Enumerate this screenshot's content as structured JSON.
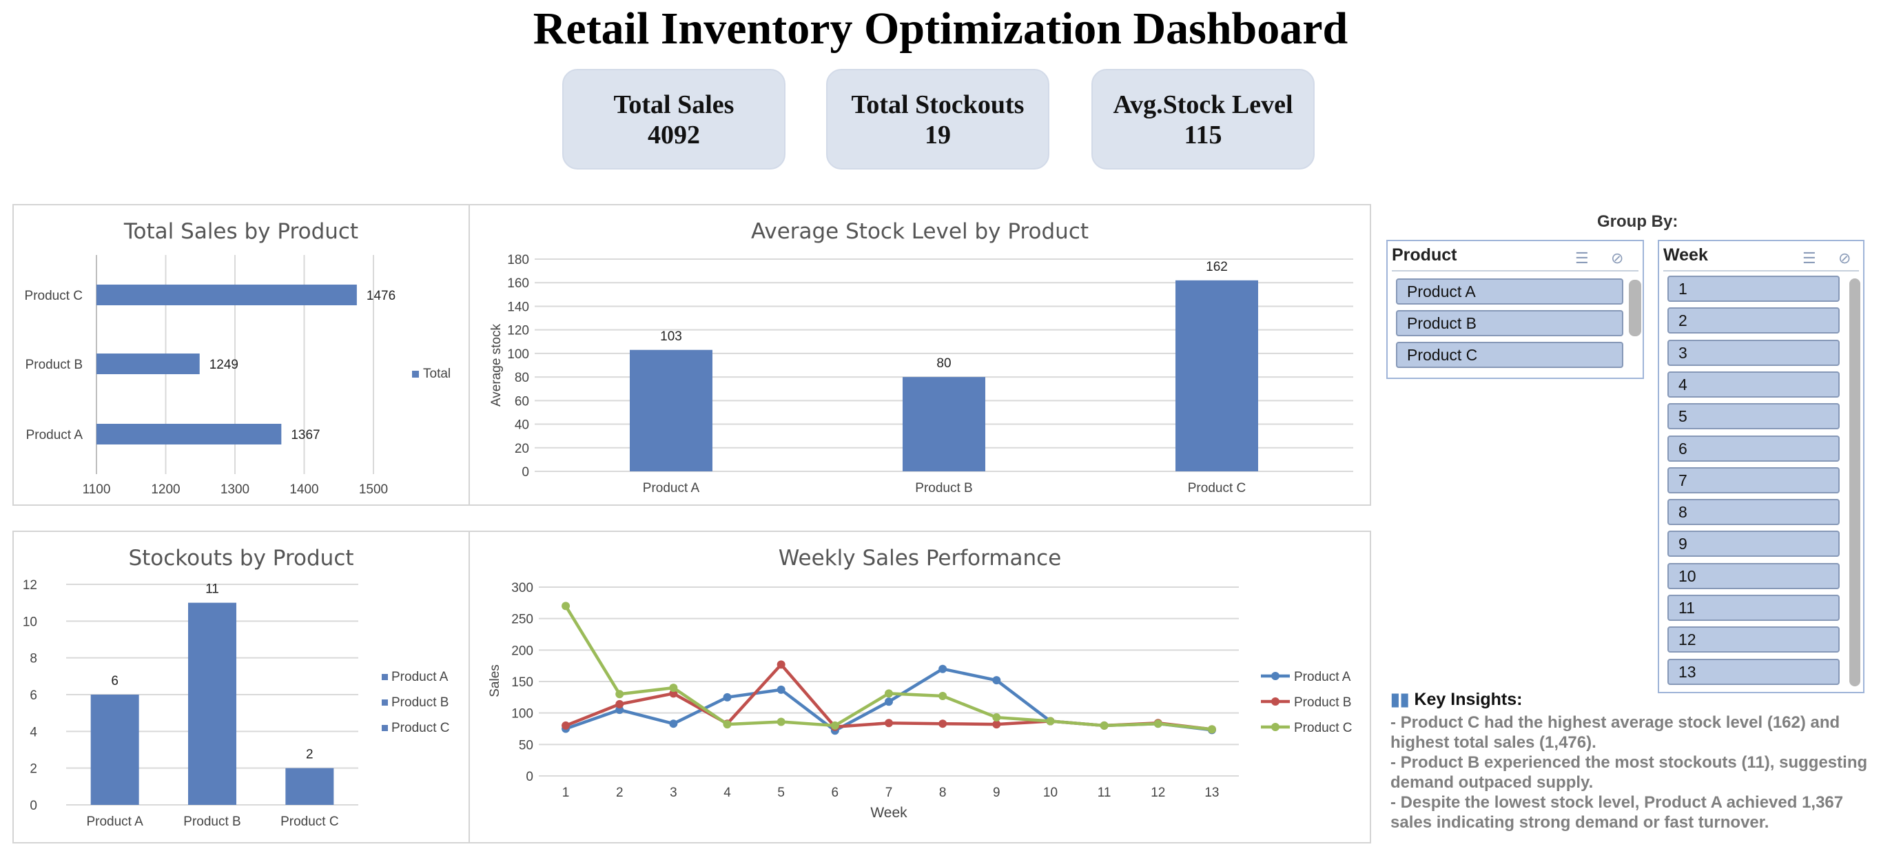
{
  "title": "Retail Inventory Optimization Dashboard",
  "kpis": [
    {
      "label": "Total Sales",
      "value": "4092"
    },
    {
      "label": "Total Stockouts",
      "value": "19"
    },
    {
      "label": "Avg.Stock Level",
      "value": "115"
    }
  ],
  "chart_data": [
    {
      "type": "bar",
      "orientation": "horizontal",
      "title": "Total Sales by Product",
      "categories": [
        "Product A",
        "Product B",
        "Product C"
      ],
      "series": [
        {
          "name": "Total",
          "values": [
            1367,
            1249,
            1476
          ]
        }
      ],
      "xlim": [
        1100,
        1500
      ],
      "ticks": [
        "1100",
        "1200",
        "1300",
        "1400",
        "1500"
      ],
      "legend": "right",
      "grid": true
    },
    {
      "type": "bar",
      "title": "Average Stock Level by Product",
      "categories": [
        "Product A",
        "Product B",
        "Product C"
      ],
      "values": [
        103,
        80,
        162
      ],
      "ylabel": "Average stock",
      "ylim": [
        0,
        180
      ],
      "ticks": [
        "0",
        "20",
        "40",
        "60",
        "80",
        "100",
        "120",
        "140",
        "160",
        "180"
      ],
      "grid": true
    },
    {
      "type": "bar",
      "title": "Stockouts by Product",
      "categories": [
        "Product A",
        "Product B",
        "Product C"
      ],
      "values": [
        6,
        11,
        2
      ],
      "ylim": [
        0,
        12
      ],
      "ticks": [
        "0",
        "2",
        "4",
        "6",
        "8",
        "10",
        "12"
      ],
      "legend_entries": [
        "Product A",
        "Product B",
        "Product C"
      ],
      "legend": "right",
      "grid": true
    },
    {
      "type": "line",
      "title": "Weekly Sales Performance",
      "x": [
        "1",
        "2",
        "3",
        "4",
        "5",
        "6",
        "7",
        "8",
        "9",
        "10",
        "11",
        "12",
        "13"
      ],
      "xlabel": "Week",
      "ylabel": "Sales",
      "ylim": [
        0,
        300
      ],
      "ticks": [
        "0",
        "50",
        "100",
        "150",
        "200",
        "250",
        "300"
      ],
      "series": [
        {
          "name": "Product A",
          "color": "#4f81bd",
          "values": [
            75,
            105,
            83,
            125,
            137,
            72,
            118,
            170,
            152,
            87,
            80,
            83,
            73
          ]
        },
        {
          "name": "Product B",
          "color": "#c0504d",
          "values": [
            80,
            114,
            131,
            83,
            177,
            78,
            84,
            83,
            82,
            87,
            80,
            84,
            74
          ]
        },
        {
          "name": "Product C",
          "color": "#9bbb59",
          "values": [
            270,
            130,
            140,
            82,
            86,
            80,
            131,
            127,
            93,
            87,
            80,
            83,
            74
          ]
        }
      ],
      "legend": "right",
      "grid": true
    }
  ],
  "groupby": {
    "label": "Group By:"
  },
  "slicers": {
    "product": {
      "header": "Product",
      "items": [
        "Product A",
        "Product B",
        "Product C"
      ]
    },
    "week": {
      "header": "Week",
      "items": [
        "1",
        "2",
        "3",
        "4",
        "5",
        "6",
        "7",
        "8",
        "9",
        "10",
        "11",
        "12",
        "13"
      ]
    }
  },
  "insights": {
    "title": "Key Insights:",
    "lines": [
      "- Product C had the highest average stock level (162) and",
      "highest total sales (1,476).",
      "- Product B experienced the most stockouts (11), suggesting",
      "demand outpaced supply.",
      "- Despite the lowest stock level, Product A achieved 1,367",
      "sales  indicating strong demand or fast turnover."
    ]
  },
  "colors": {
    "bar": "#5b7fbb",
    "kpi_bg": "#dce3ee",
    "slicer_item": "#b9c9e3"
  },
  "icons": {
    "multi_select": "multi-select-icon",
    "clear_filter": "clear-filter-icon",
    "insights": "bar-chart-icon"
  }
}
